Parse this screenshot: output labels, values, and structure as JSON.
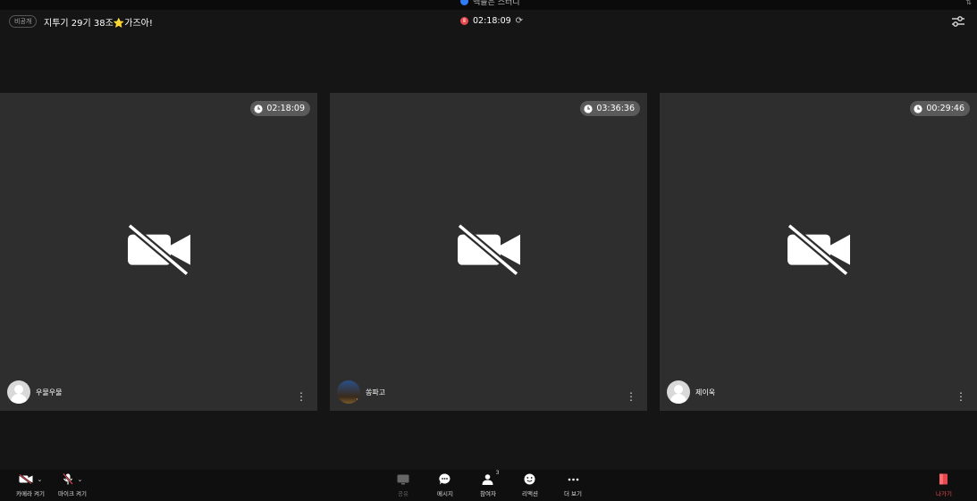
{
  "top_strip": {
    "notice": "백들은 스터디"
  },
  "header": {
    "visibility_badge": "비공개",
    "room_title": "지투기 29기 38조⭐가즈아!",
    "recording_time": "02:18:09"
  },
  "participants": [
    {
      "name": "우물우물",
      "timer": "02:18:09"
    },
    {
      "name": "쏭파고",
      "timer": "03:36:36"
    },
    {
      "name": "제이욱",
      "timer": "00:29:46"
    }
  ],
  "toolbar": {
    "camera_label": "카메라 켜기",
    "mic_label": "마이크 켜기",
    "share_label": "공유",
    "message_label": "메시지",
    "participants_label": "참여자",
    "participants_count": "3",
    "reaction_label": "리액션",
    "more_label": "더 보기",
    "leave_label": "나가기"
  },
  "colors": {
    "background": "#151515",
    "tile": "#2e2e2e",
    "record_red": "#e5484d",
    "leave_red": "#e5484d",
    "notice_blue": "#2f7cf6"
  },
  "icons": {
    "camera_off": "video-off-icon",
    "mic_off": "mic-off-icon",
    "share": "screen-share-icon",
    "message": "chat-bubble-icon",
    "participants": "person-icon",
    "reaction": "smile-icon",
    "more": "ellipsis-icon",
    "leave": "door-icon",
    "settings": "sliders-icon",
    "timer": "clock-icon"
  }
}
